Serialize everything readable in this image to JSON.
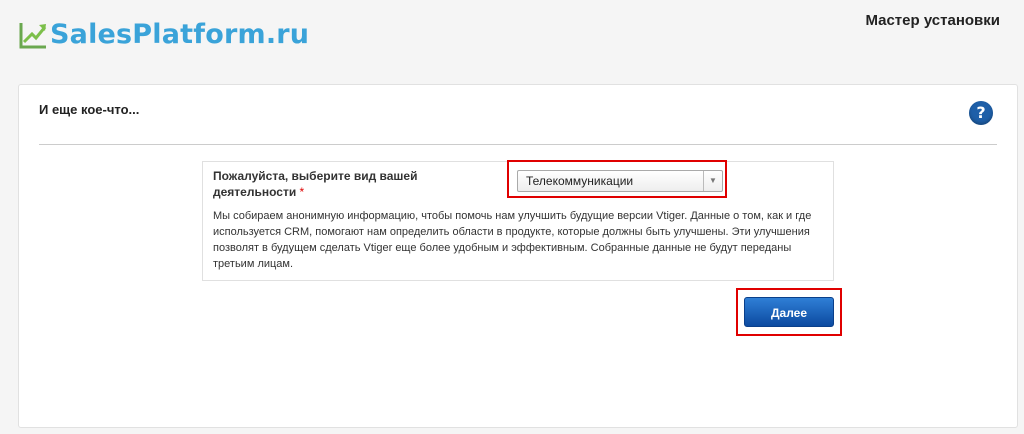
{
  "header": {
    "logo_text": "SalesPlatform.ru",
    "title": "Мастер установки"
  },
  "panel": {
    "title": "И еще кое-что...",
    "help_icon_glyph": "?"
  },
  "form": {
    "label": "Пожалуйста, выберите вид вашей деятельности",
    "required_marker": "*",
    "industry_select": {
      "selected": "Телекоммуникации",
      "arrow": "▼"
    },
    "description": "Мы собираем анонимную информацию, чтобы помочь нам улучшить будущие версии Vtiger. Данные о том, как и где используется CRM, помогают нам определить области в продукте, которые должны быть улучшены. Эти улучшения позволят в будущем сделать Vtiger еще более удобным и эффективным. Собранные данные не будут переданы третьим лицам."
  },
  "actions": {
    "next_label": "Далее"
  },
  "colors": {
    "accent_blue": "#3aa3d9",
    "button_blue": "#1a5fb4",
    "highlight_red": "#e00000",
    "help_icon": "#1e5fa8"
  }
}
